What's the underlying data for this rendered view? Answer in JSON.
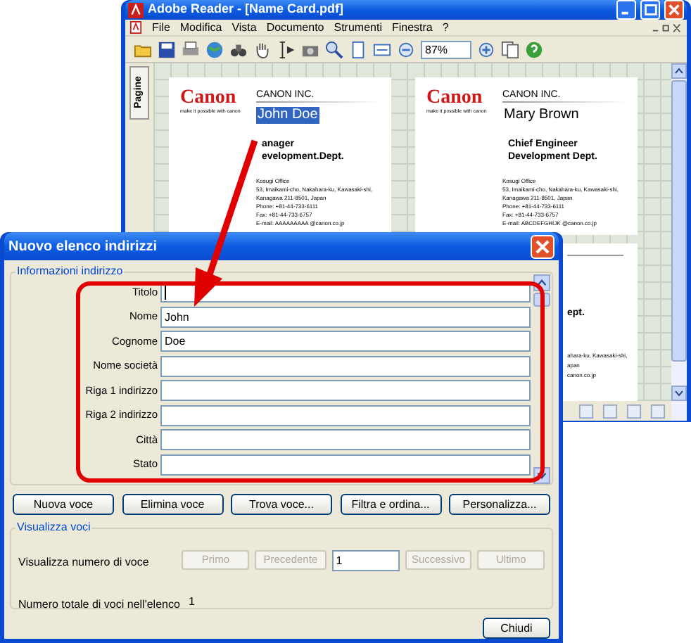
{
  "reader_window": {
    "title": "Adobe Reader - [Name Card.pdf]",
    "menu": [
      "File",
      "Modifica",
      "Vista",
      "Documento",
      "Strumenti",
      "Finestra",
      "?"
    ],
    "zoom_value": "87%",
    "side_tab": "Pagine",
    "cards": [
      {
        "kind": "full",
        "logo": "Canon",
        "tagline": "make it possible with canon",
        "company": "CANON INC.",
        "name": "John Doe",
        "name_selected": true,
        "title_lines": [
          "anager",
          "evelopment.Dept."
        ],
        "address": [
          "Kosugi Office",
          "53, Imaikami-cho, Nakahara-ku, Kawasaki-shi,",
          "Kanagawa 211-8501, Japan",
          "Phone: +81-44-733-6111",
          "Fax: +81-44-733-6757",
          "E-mail: AAAAAAAAA @canon.co.jp"
        ]
      },
      {
        "kind": "full",
        "logo": "Canon",
        "tagline": "make it possible with canon",
        "company": "CANON INC.",
        "name": "Mary Brown",
        "name_selected": false,
        "title_lines": [
          "Chief Engineer",
          "Development Dept."
        ],
        "address": [
          "Kosugi Office",
          "53, Imaikami-cho, Nakahara-ku, Kawasaki-shi,",
          "Kanagawa 211-8501, Japan",
          "Phone: +81-44-733-6111",
          "Fax: +81-44-733-6757",
          "E-mail: ABCDEFGHIJK @canon.co.jp"
        ]
      },
      {
        "kind": "partial",
        "title_lines": [
          "ept."
        ],
        "address": [
          "ahara-ku, Kawasaki-shi,",
          "apan",
          "canon.co.jp"
        ]
      }
    ]
  },
  "dialog": {
    "title": "Nuovo elenco indirizzi",
    "group_label": "Informazioni indirizzo",
    "fields": [
      {
        "label": "Titolo",
        "focused": true
      },
      {
        "label": "Nome",
        "value": "John",
        "focused": false
      },
      {
        "label": "Cognome",
        "value": "Doe",
        "focused": false
      },
      {
        "label": "Nome società",
        "focused": false
      },
      {
        "label": "Riga 1 indirizzo",
        "focused": false
      },
      {
        "label": "Riga 2 indirizzo",
        "focused": false
      },
      {
        "label": "Città",
        "focused": false
      },
      {
        "label": "Stato",
        "focused": false
      }
    ],
    "buttons": [
      "Nuova voce",
      "Elimina voce",
      "Trova voce...",
      "Filtra e ordina...",
      "Personalizza..."
    ],
    "view_group_label": "Visualizza voci",
    "entry_number_label": "Visualizza numero di voce",
    "nav_buttons": [
      {
        "label": "Primo",
        "disabled": true
      },
      {
        "label": "Precedente",
        "disabled": true
      },
      {
        "label": "Successivo",
        "disabled": true
      },
      {
        "label": "Ultimo",
        "disabled": true
      }
    ],
    "entry_number_value": "1",
    "total_label": "Numero totale di voci nell'elenco",
    "total_value": "1",
    "close_button": "Chiudi"
  }
}
